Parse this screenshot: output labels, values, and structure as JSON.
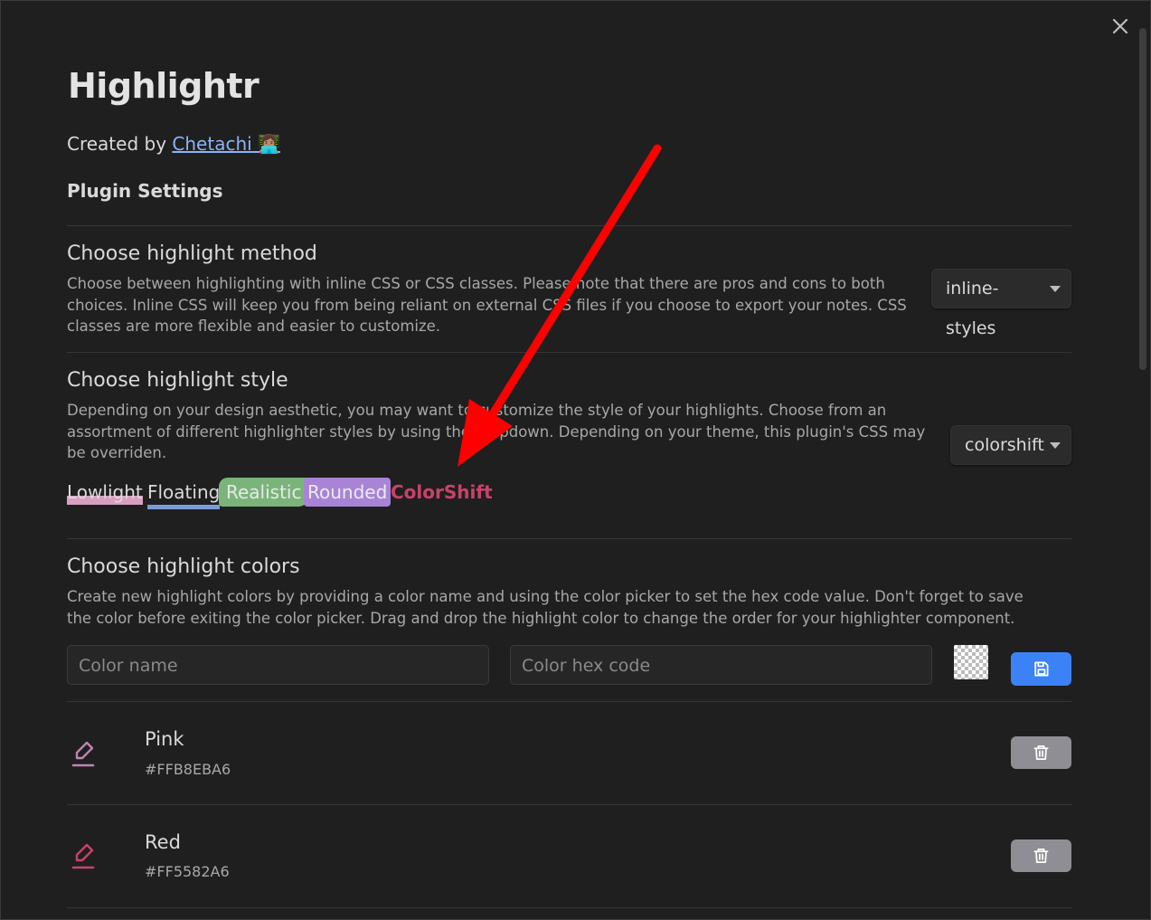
{
  "header": {
    "title": "Highlightr",
    "created_prefix": "Created by ",
    "author": "Chetachi",
    "author_emoji": "👩🏽‍💻",
    "section_title": "Plugin Settings"
  },
  "settings": {
    "method": {
      "name": "Choose highlight method",
      "desc": "Choose between highlighting with inline CSS or CSS classes. Please note that there are pros and cons to both choices. Inline CSS will keep you from being reliant on external CSS files if you choose to export your notes. CSS classes are more flexible and easier to customize.",
      "value": "inline-styles"
    },
    "style": {
      "name": "Choose highlight style",
      "desc": "Depending on your design aesthetic, you may want to customize the style of your highlights. Choose from an assortment of different highlighter styles by using the dropdown. Depending on your theme, this plugin's CSS may be overriden.",
      "value": "colorshift",
      "previews": [
        "Lowlight",
        "Floating",
        "Realistic",
        "Rounded",
        "ColorShift"
      ]
    },
    "colors": {
      "name": "Choose highlight colors",
      "desc": "Create new highlight colors by providing a color name and using the color picker to set the hex code value. Don't forget to save the color before exiting the color picker. Drag and drop the highlight color to change the order for your highlighter component.",
      "name_placeholder": "Color name",
      "hex_placeholder": "Color hex code",
      "items": [
        {
          "name": "Pink",
          "hex": "#FFB8EBA6",
          "icon_color": "#c083b5"
        },
        {
          "name": "Red",
          "hex": "#FF5582A6",
          "icon_color": "#c8446a"
        }
      ]
    }
  },
  "icons": {
    "close": "close-icon",
    "save": "save-icon",
    "delete": "trash-icon",
    "highlighter": "highlighter-icon"
  },
  "colors": {
    "accent": "#3b82f6",
    "link": "#8ab4f8",
    "arrow": "#ff0000"
  }
}
